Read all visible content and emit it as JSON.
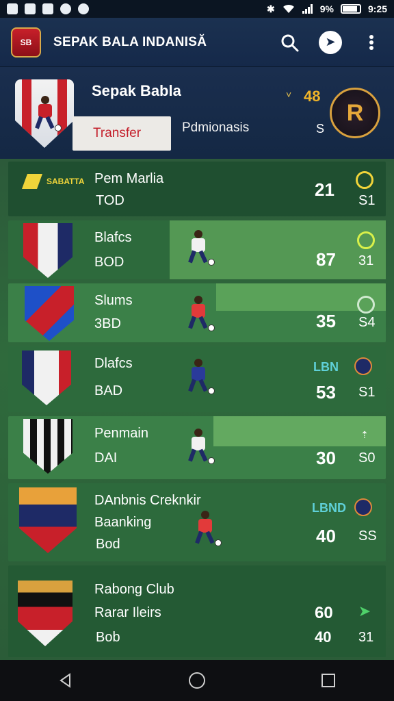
{
  "status_bar": {
    "battery": "9%",
    "time": "9:25"
  },
  "app_bar": {
    "logo_text": "SB",
    "title": "SEPAK BALA INDANISĂ"
  },
  "hero": {
    "title": "Sepak Babla",
    "transfer_button": "Transfer",
    "promo_label": "Pdmionasis",
    "chevron": "˅",
    "score": "48",
    "score_sub": "S"
  },
  "rows": [
    {
      "sponsor": "SABATTA",
      "name": "Pem Marlia",
      "sub": "TOD",
      "num": "21",
      "side": "S1"
    },
    {
      "name": "Blafcs",
      "sub": "BOD",
      "num": "87",
      "side": "31"
    },
    {
      "name": "Slums",
      "sub": "3BD",
      "num": "35",
      "side": "S4"
    },
    {
      "name": "Dlafcs",
      "sub": "BAD",
      "num": "53",
      "side": "S1",
      "tag": "LBN"
    },
    {
      "name": "Penmain",
      "sub": "DAI",
      "num": "30",
      "side": "S0"
    },
    {
      "name": "DAnbnis Creknkir",
      "name2": "Baanking",
      "sub": "Bod",
      "num": "40",
      "side": "SS",
      "tag": "LBND"
    },
    {
      "name": "Rabong Club",
      "name2": "Rarar Ileirs",
      "sub": "Bob",
      "num": "60",
      "num2": "40",
      "side": "31"
    }
  ],
  "colors": {
    "header": "#15294a",
    "row_dark": "#1f4f30",
    "row_light": "#3b8048",
    "accent_red": "#c41e2a",
    "accent_gold": "#f0b429"
  }
}
